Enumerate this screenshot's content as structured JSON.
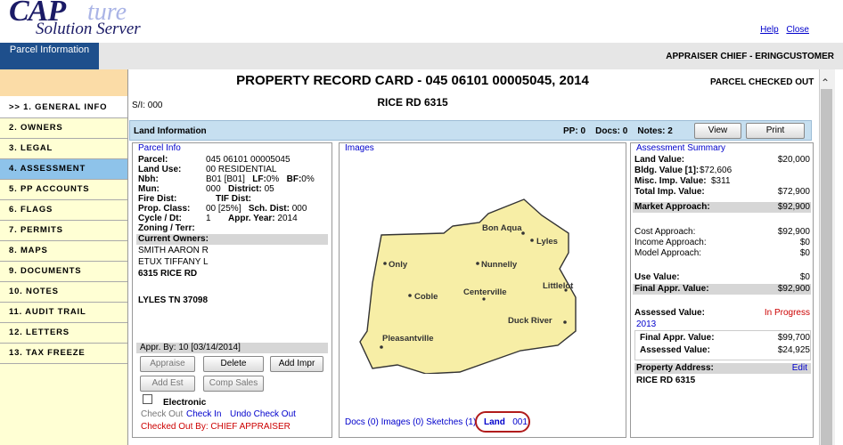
{
  "header": {
    "logo_cap": "CAP",
    "logo_ture": "ture",
    "logo_sub": "Solution Server",
    "help": "Help",
    "close": "Close",
    "user": "APPRAISER CHIEF - ERINGCUSTOMER",
    "parcel_tab": "Parcel Information"
  },
  "nav": [
    "1. GENERAL INFO",
    "2. OWNERS",
    "3. LEGAL",
    "4. ASSESSMENT",
    "5. PP ACCOUNTS",
    "6. FLAGS",
    "7. PERMITS",
    "8. MAPS",
    "9. DOCUMENTS",
    "10. NOTES",
    "11. AUDIT TRAIL",
    "12. LETTERS",
    "13. TAX FREEZE"
  ],
  "nav_current_marker": ">>",
  "main": {
    "title": "PROPERTY RECORD CARD - 045 06101 00005045, 2014",
    "status": "PARCEL CHECKED OUT",
    "road": "RICE RD 6315",
    "si": "S/I: 000",
    "land_info": "Land Information",
    "pp": "PP: 0",
    "docs": "Docs: 0",
    "notes": "Notes: 2",
    "view_btn": "View",
    "print_btn": "Print"
  },
  "parcel_info": {
    "title": "Parcel Info",
    "parcel_label": "Parcel:",
    "parcel_value": "045 06101 00005045",
    "land_use_label": "Land Use:",
    "land_use_value": "00 RESIDENTIAL",
    "nbh_label": "Nbh:",
    "nbh_value": "B01 [B01]",
    "lf_label": "LF:",
    "lf_value": "0%",
    "bf_label": "BF:",
    "bf_value": "0%",
    "mun_label": "Mun:",
    "mun_value": "000",
    "district_label": "District:",
    "district_value": "05",
    "fire_label": "Fire Dist:",
    "tif_label": "TIF Dist:",
    "prop_class_label": "Prop. Class:",
    "prop_class_value": "00 [25%]",
    "sch_label": "Sch. Dist:",
    "sch_value": "000",
    "cycle_label": "Cycle / Dt:",
    "cycle_value": "1",
    "appr_year_label": "Appr. Year:",
    "appr_year_value": "2014",
    "zoning_label": "Zoning / Terr:",
    "owners_label": "Current Owners:",
    "owner1": "SMITH AARON R",
    "owner2": "ETUX TIFFANY L",
    "owner_addr": "6315 RICE RD",
    "owner_city": "LYLES TN 37098",
    "appr_by": "Appr. By: 10 [03/14/2014]",
    "appraise_btn": "Appraise",
    "delete_btn": "Delete",
    "add_impr_btn": "Add Impr",
    "add_est_btn": "Add Est",
    "comp_sales_btn": "Comp Sales",
    "electronic": "Electronic",
    "check_out": "Check Out",
    "check_in": "Check In",
    "undo_check_out": "Undo Check Out",
    "checked_out_by": "Checked Out By: CHIEF APPRAISER"
  },
  "images": {
    "title": "Images",
    "docs_link": "Docs (0)",
    "images_link": "Images (0)",
    "sketches_link": "Sketches (1)",
    "land_link": "Land",
    "land_num": "001",
    "towns": [
      "Bon Aqua",
      "Lyles",
      "Only",
      "Nunnelly",
      "Littlelot",
      "Centerville",
      "Coble",
      "Duck River",
      "Pleasantville"
    ]
  },
  "assessment": {
    "title": "Assessment Summary",
    "land_value_label": "Land Value:",
    "land_value": "$20,000",
    "bldg_label": "Bldg. Value [1]:",
    "bldg_value": "$72,606",
    "misc_label": "Misc. Imp. Value:",
    "misc_value": "$311",
    "total_imp_label": "Total Imp. Value:",
    "total_imp_value": "$72,900",
    "market_label": "Market Approach:",
    "market_value": "$92,900",
    "cost_label": "Cost Approach:",
    "cost_value": "$92,900",
    "income_label": "Income Approach:",
    "income_value": "$0",
    "model_label": "Model Approach:",
    "model_value": "$0",
    "use_label": "Use Value:",
    "use_value": "$0",
    "final_label": "Final Appr. Value:",
    "final_value": "$92,900",
    "assessed_label": "Assessed Value:",
    "assessed_value": "In Progress",
    "prior_year": "2013",
    "prior_final_label": "Final Appr. Value:",
    "prior_final_value": "$99,700",
    "prior_assessed_label": "Assessed Value:",
    "prior_assessed_value": "$24,925",
    "property_address_label": "Property Address:",
    "edit": "Edit",
    "property_address": "RICE RD 6315"
  },
  "colors": {
    "nav_bg": "#ffffd4",
    "nav_active": "#8ec3ea",
    "land_bar": "#c6dff0",
    "parcel_tab": "#1e4f8c",
    "map_fill": "#f7eea6"
  }
}
